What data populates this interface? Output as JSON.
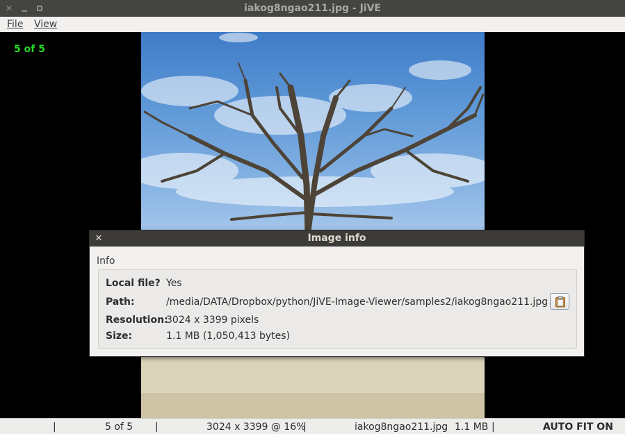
{
  "window": {
    "title": "iakog8ngao211.jpg - JiVE"
  },
  "menu": {
    "file_label": "File",
    "view_label": "View"
  },
  "viewer": {
    "counter": "5 of 5"
  },
  "dialog": {
    "title": "Image info",
    "group_label": "Info",
    "rows": [
      {
        "key": "Local file?",
        "value": "Yes"
      },
      {
        "key": "Path:",
        "value": "/media/DATA/Dropbox/python/JiVE-Image-Viewer/samples2/iakog8ngao211.jpg"
      },
      {
        "key": "Resolution:",
        "value": "3024 x 3399 pixels"
      },
      {
        "key": "Size:",
        "value": "1.1 MB (1,050,413 bytes)"
      }
    ],
    "copy_icon": "clipboard-icon"
  },
  "status": {
    "sep": "|",
    "position": "5 of 5",
    "dims_zoom": "3024 x 3399 @ 16%",
    "filename": "iakog8ngao211.jpg",
    "filesize": "1.1 MB",
    "fit_mode": "AUTO FIT ON"
  },
  "colors": {
    "counter": "#26d926",
    "titlebar": "#444440",
    "dialog_title": "#3c3b37"
  }
}
